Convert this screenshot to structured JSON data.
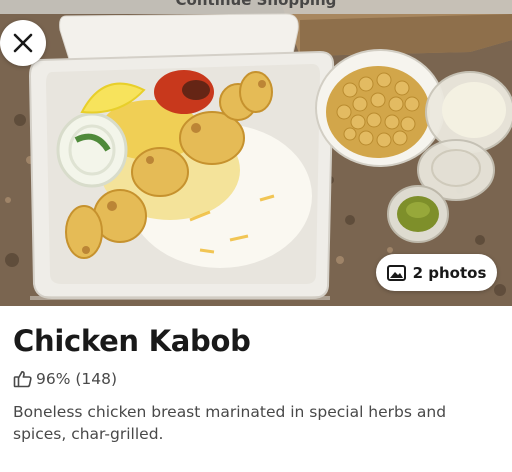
{
  "header": {
    "partial_title": "Continue Shopping"
  },
  "hero": {
    "photo_subject": "Chicken kabob plate in foam container with rice, tomato, lemon, chickpeas and sauces"
  },
  "close_button": {
    "icon": "close-icon"
  },
  "photos_button": {
    "icon": "image-gallery-icon",
    "label": "2 photos"
  },
  "item": {
    "name": "Chicken Kabob",
    "rating_icon": "thumbs-up-icon",
    "rating_text": "96% (148)",
    "description": "Boneless chicken breast marinated in special herbs and spices, char-grilled."
  }
}
